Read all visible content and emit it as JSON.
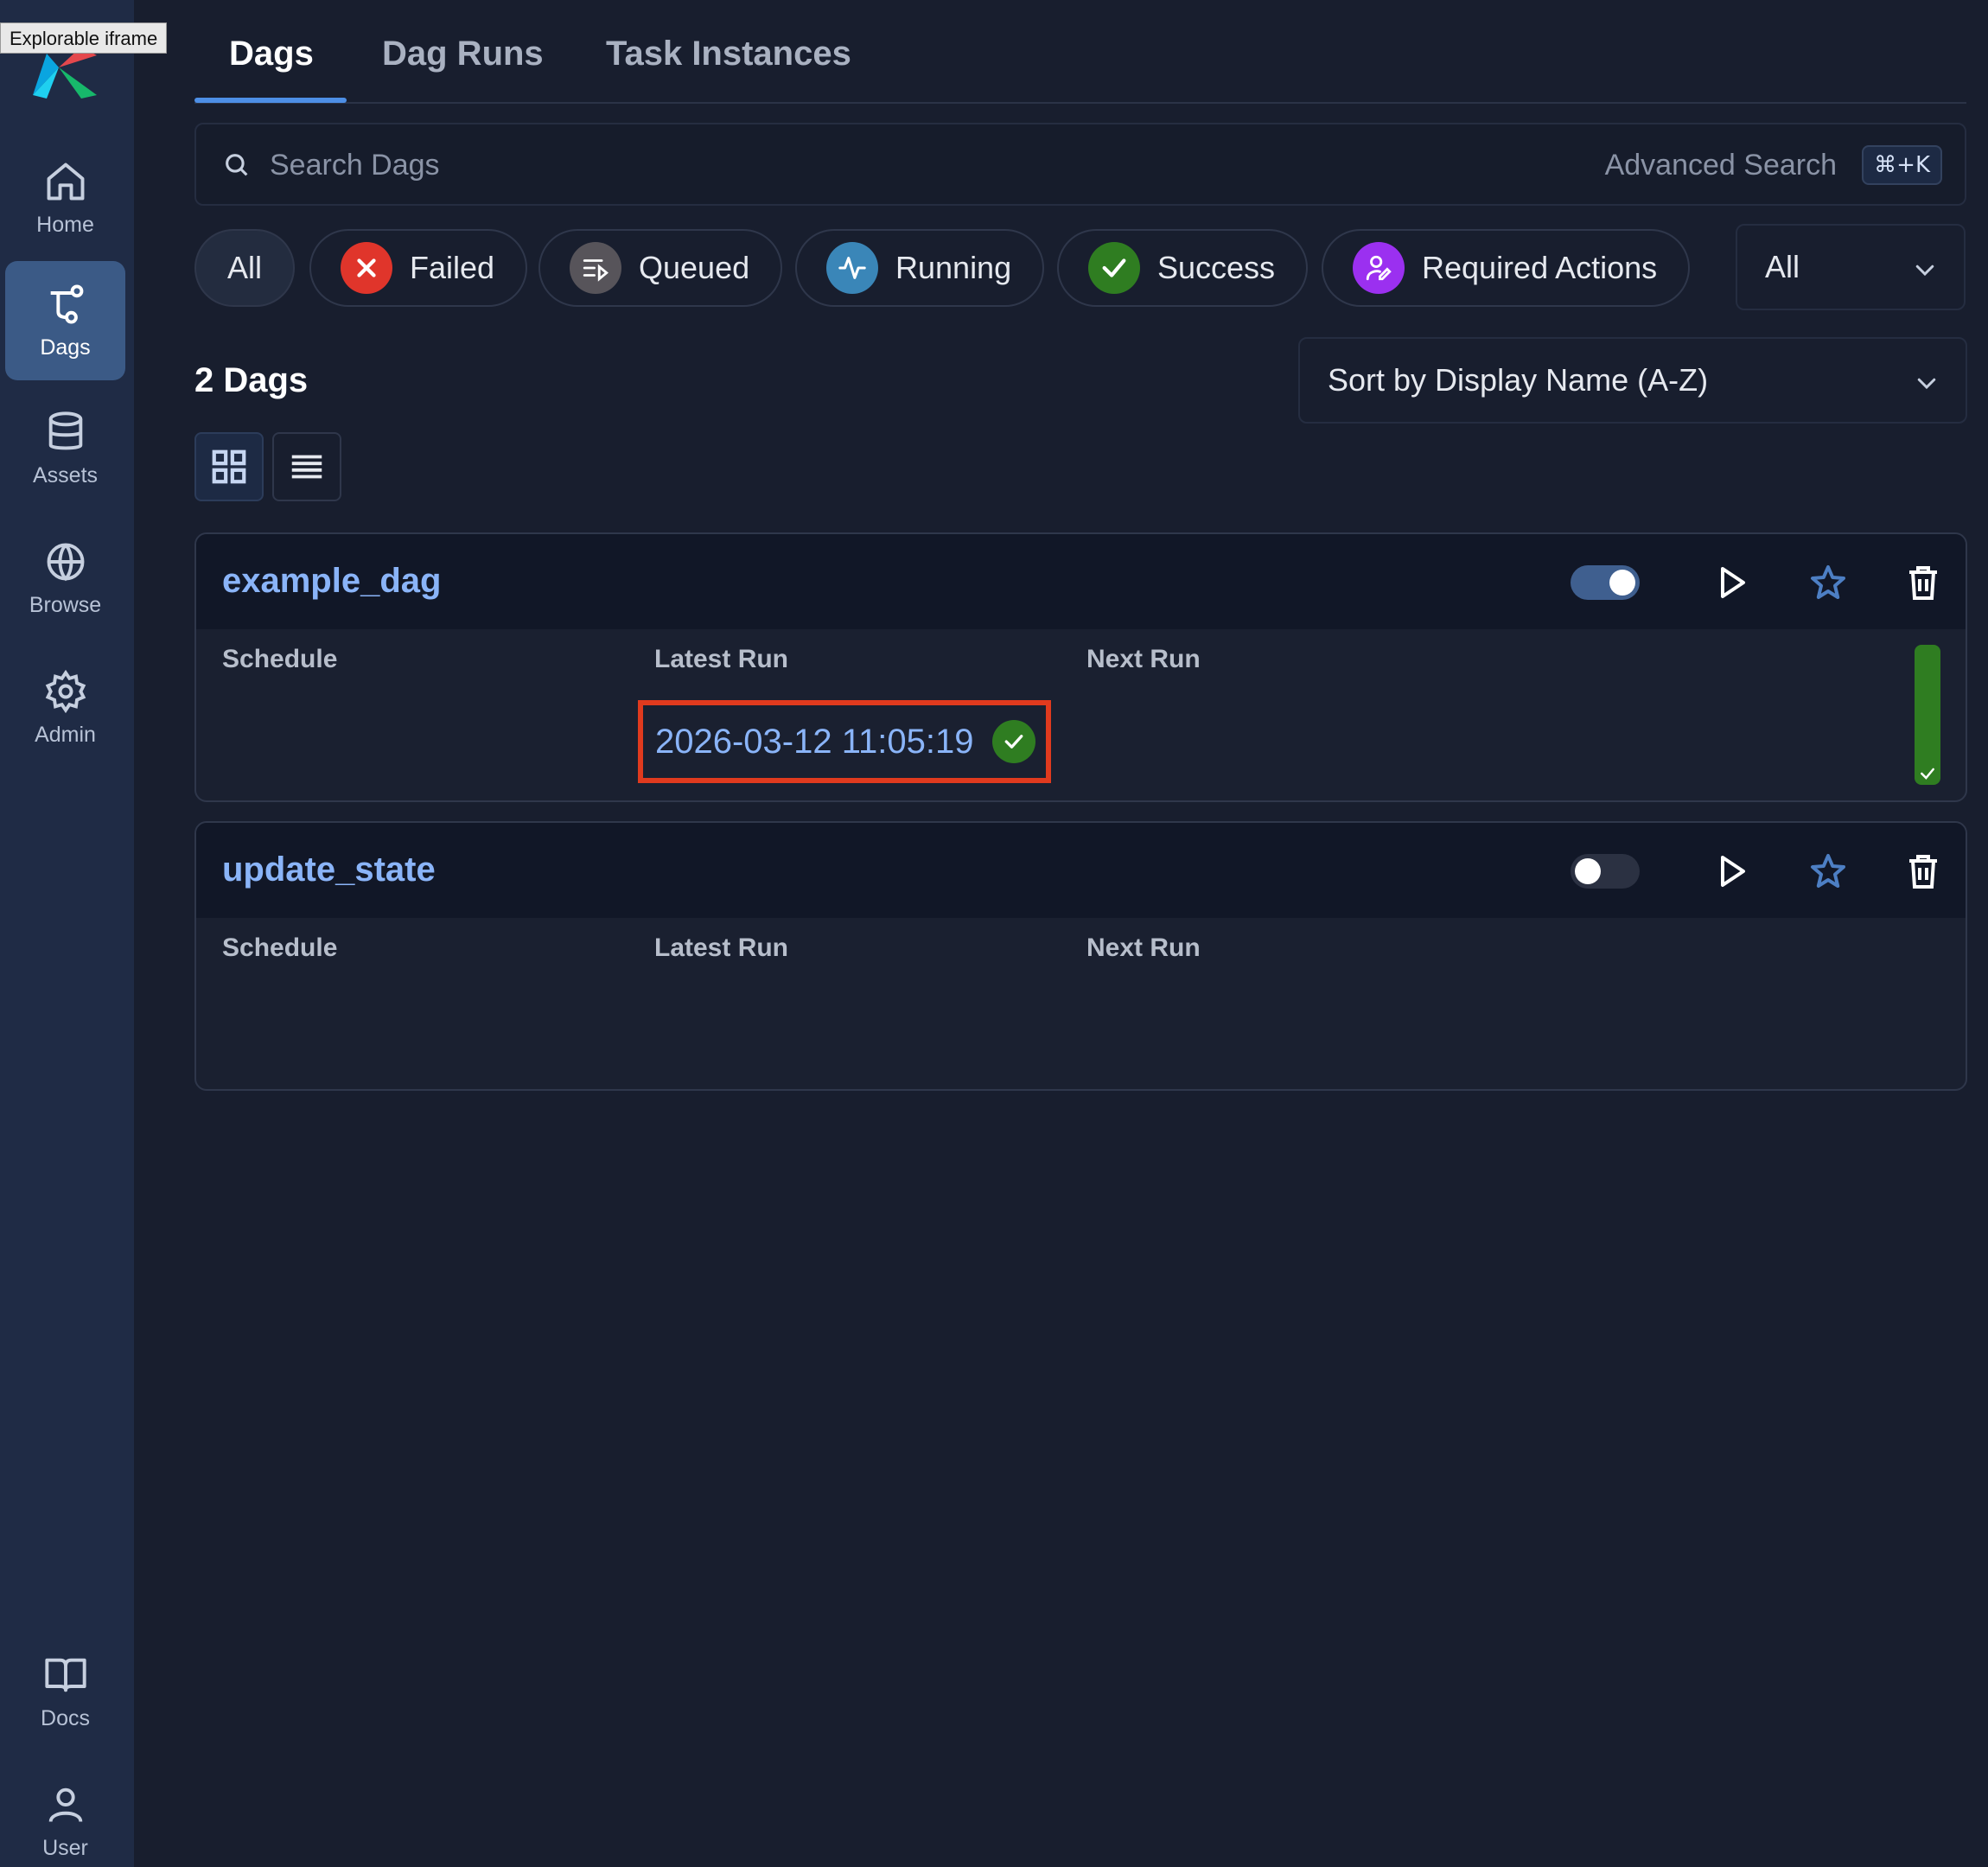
{
  "overlay": {
    "tooltip": "Explorable iframe"
  },
  "sidebar": {
    "items": [
      {
        "label": "Home",
        "icon": "home-icon"
      },
      {
        "label": "Dags",
        "icon": "dags-icon",
        "active": true
      },
      {
        "label": "Assets",
        "icon": "database-icon"
      },
      {
        "label": "Browse",
        "icon": "globe-icon"
      },
      {
        "label": "Admin",
        "icon": "gear-icon"
      },
      {
        "label": "Docs",
        "icon": "book-icon"
      },
      {
        "label": "User",
        "icon": "user-icon"
      }
    ]
  },
  "tabs": [
    {
      "label": "Dags",
      "active": true
    },
    {
      "label": "Dag Runs"
    },
    {
      "label": "Task Instances"
    }
  ],
  "search": {
    "placeholder": "Search Dags",
    "advanced_label": "Advanced Search",
    "shortcut": "⌘+K"
  },
  "filters": [
    {
      "label": "All",
      "active": true
    },
    {
      "label": "Failed",
      "color": "#e0352b",
      "icon": "x-icon"
    },
    {
      "label": "Queued",
      "color": "#57545a",
      "icon": "queue-icon"
    },
    {
      "label": "Running",
      "color": "#3a86b8",
      "icon": "activity-icon"
    },
    {
      "label": "Success",
      "color": "#2f7d21",
      "icon": "check-icon"
    },
    {
      "label": "Required Actions",
      "color": "#9b30f0",
      "icon": "user-edit-icon"
    }
  ],
  "paused_filter": {
    "value": "All"
  },
  "summary": {
    "count_label": "2 Dags"
  },
  "sort": {
    "value": "Sort by Display Name (A-Z)"
  },
  "columns": {
    "schedule": "Schedule",
    "latest_run": "Latest Run",
    "next_run": "Next Run"
  },
  "dags": [
    {
      "name": "example_dag",
      "enabled": true,
      "latest_run": "2026-03-12 11:05:19",
      "latest_run_state": "success",
      "schedule": "",
      "next_run": ""
    },
    {
      "name": "update_state",
      "enabled": false,
      "latest_run": "",
      "schedule": "",
      "next_run": ""
    }
  ],
  "colors": {
    "accent": "#4d8fe6",
    "link": "#8ab4f8",
    "success": "#2f7d21",
    "highlight": "#e03a1e"
  }
}
